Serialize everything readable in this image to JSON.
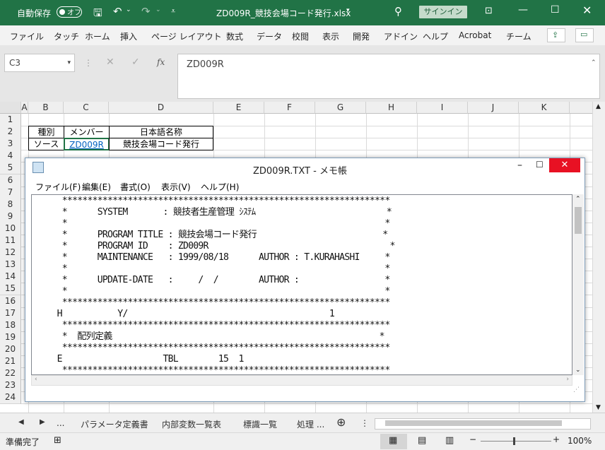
{
  "titlebar": {
    "autosave": "自動保存",
    "autosave_state": "オフ",
    "filename": "ZD009R_競技会場コード発行.xlsx",
    "signin": "サインイン"
  },
  "ribbon": {
    "tabs": [
      "ファイル",
      "タッチ",
      "ホーム",
      "挿入",
      "ページ レイアウト",
      "数式",
      "データ",
      "校閲",
      "表示",
      "開発",
      "アドイン",
      "ヘルプ",
      "Acrobat",
      "チーム"
    ]
  },
  "formula": {
    "namebox": "C3",
    "value": "ZD009R",
    "fx": "fx"
  },
  "grid": {
    "columns": [
      "A",
      "B",
      "C",
      "D",
      "E",
      "F",
      "G",
      "H",
      "I",
      "J",
      "K"
    ],
    "rows": [
      "1",
      "2",
      "3",
      "4",
      "5",
      "6",
      "7",
      "8",
      "9",
      "10",
      "11",
      "12",
      "13",
      "14",
      "15",
      "16",
      "17",
      "18",
      "19",
      "20",
      "21",
      "22",
      "23",
      "24"
    ],
    "headers": {
      "b": "種別",
      "c": "メンバー",
      "d": "日本語名称"
    },
    "row3": {
      "b": "ソース",
      "c": "ZD009R",
      "d": "競技会場コード発行"
    }
  },
  "sheets": {
    "ellipsis": "...",
    "tabs": [
      "パラメータ定義書",
      "内部変数一覧表",
      "標識一覧",
      "処理 ..."
    ]
  },
  "status": {
    "ready": "準備完了",
    "zoom": "100%"
  },
  "notepad": {
    "title": "ZD009R.TXT - メモ帳",
    "menu": [
      "ファイル(F)",
      "編集(E)",
      "書式(O)",
      "表示(V)",
      "ヘルプ(H)"
    ],
    "lines": [
      "      *****************************************************************",
      "      *      SYSTEM       : 競技者生産管理 ｼｽﾃﾑ                          *",
      "      *                                                               *",
      "      *      PROGRAM TITLE : 競技会場コード発行                         *",
      "      *      PROGRAM ID    : ZD009R                                    *",
      "      *      MAINTENANCE   : 1999/08/18      AUTHOR : T.KURAHASHI     *",
      "      *                                                               *",
      "      *      UPDATE-DATE   :     /  /        AUTHOR :                 *",
      "      *                                                               *",
      "      *****************************************************************",
      "     H           Y/                                        1",
      "      *****************************************************************",
      "      *  配列定義                                                     *",
      "      *****************************************************************",
      "     E                    TBL        15  1",
      "      *****************************************************************"
    ]
  },
  "colors": {
    "excel_green": "#217346",
    "close_red": "#e81123",
    "link_blue": "#0563c1"
  }
}
